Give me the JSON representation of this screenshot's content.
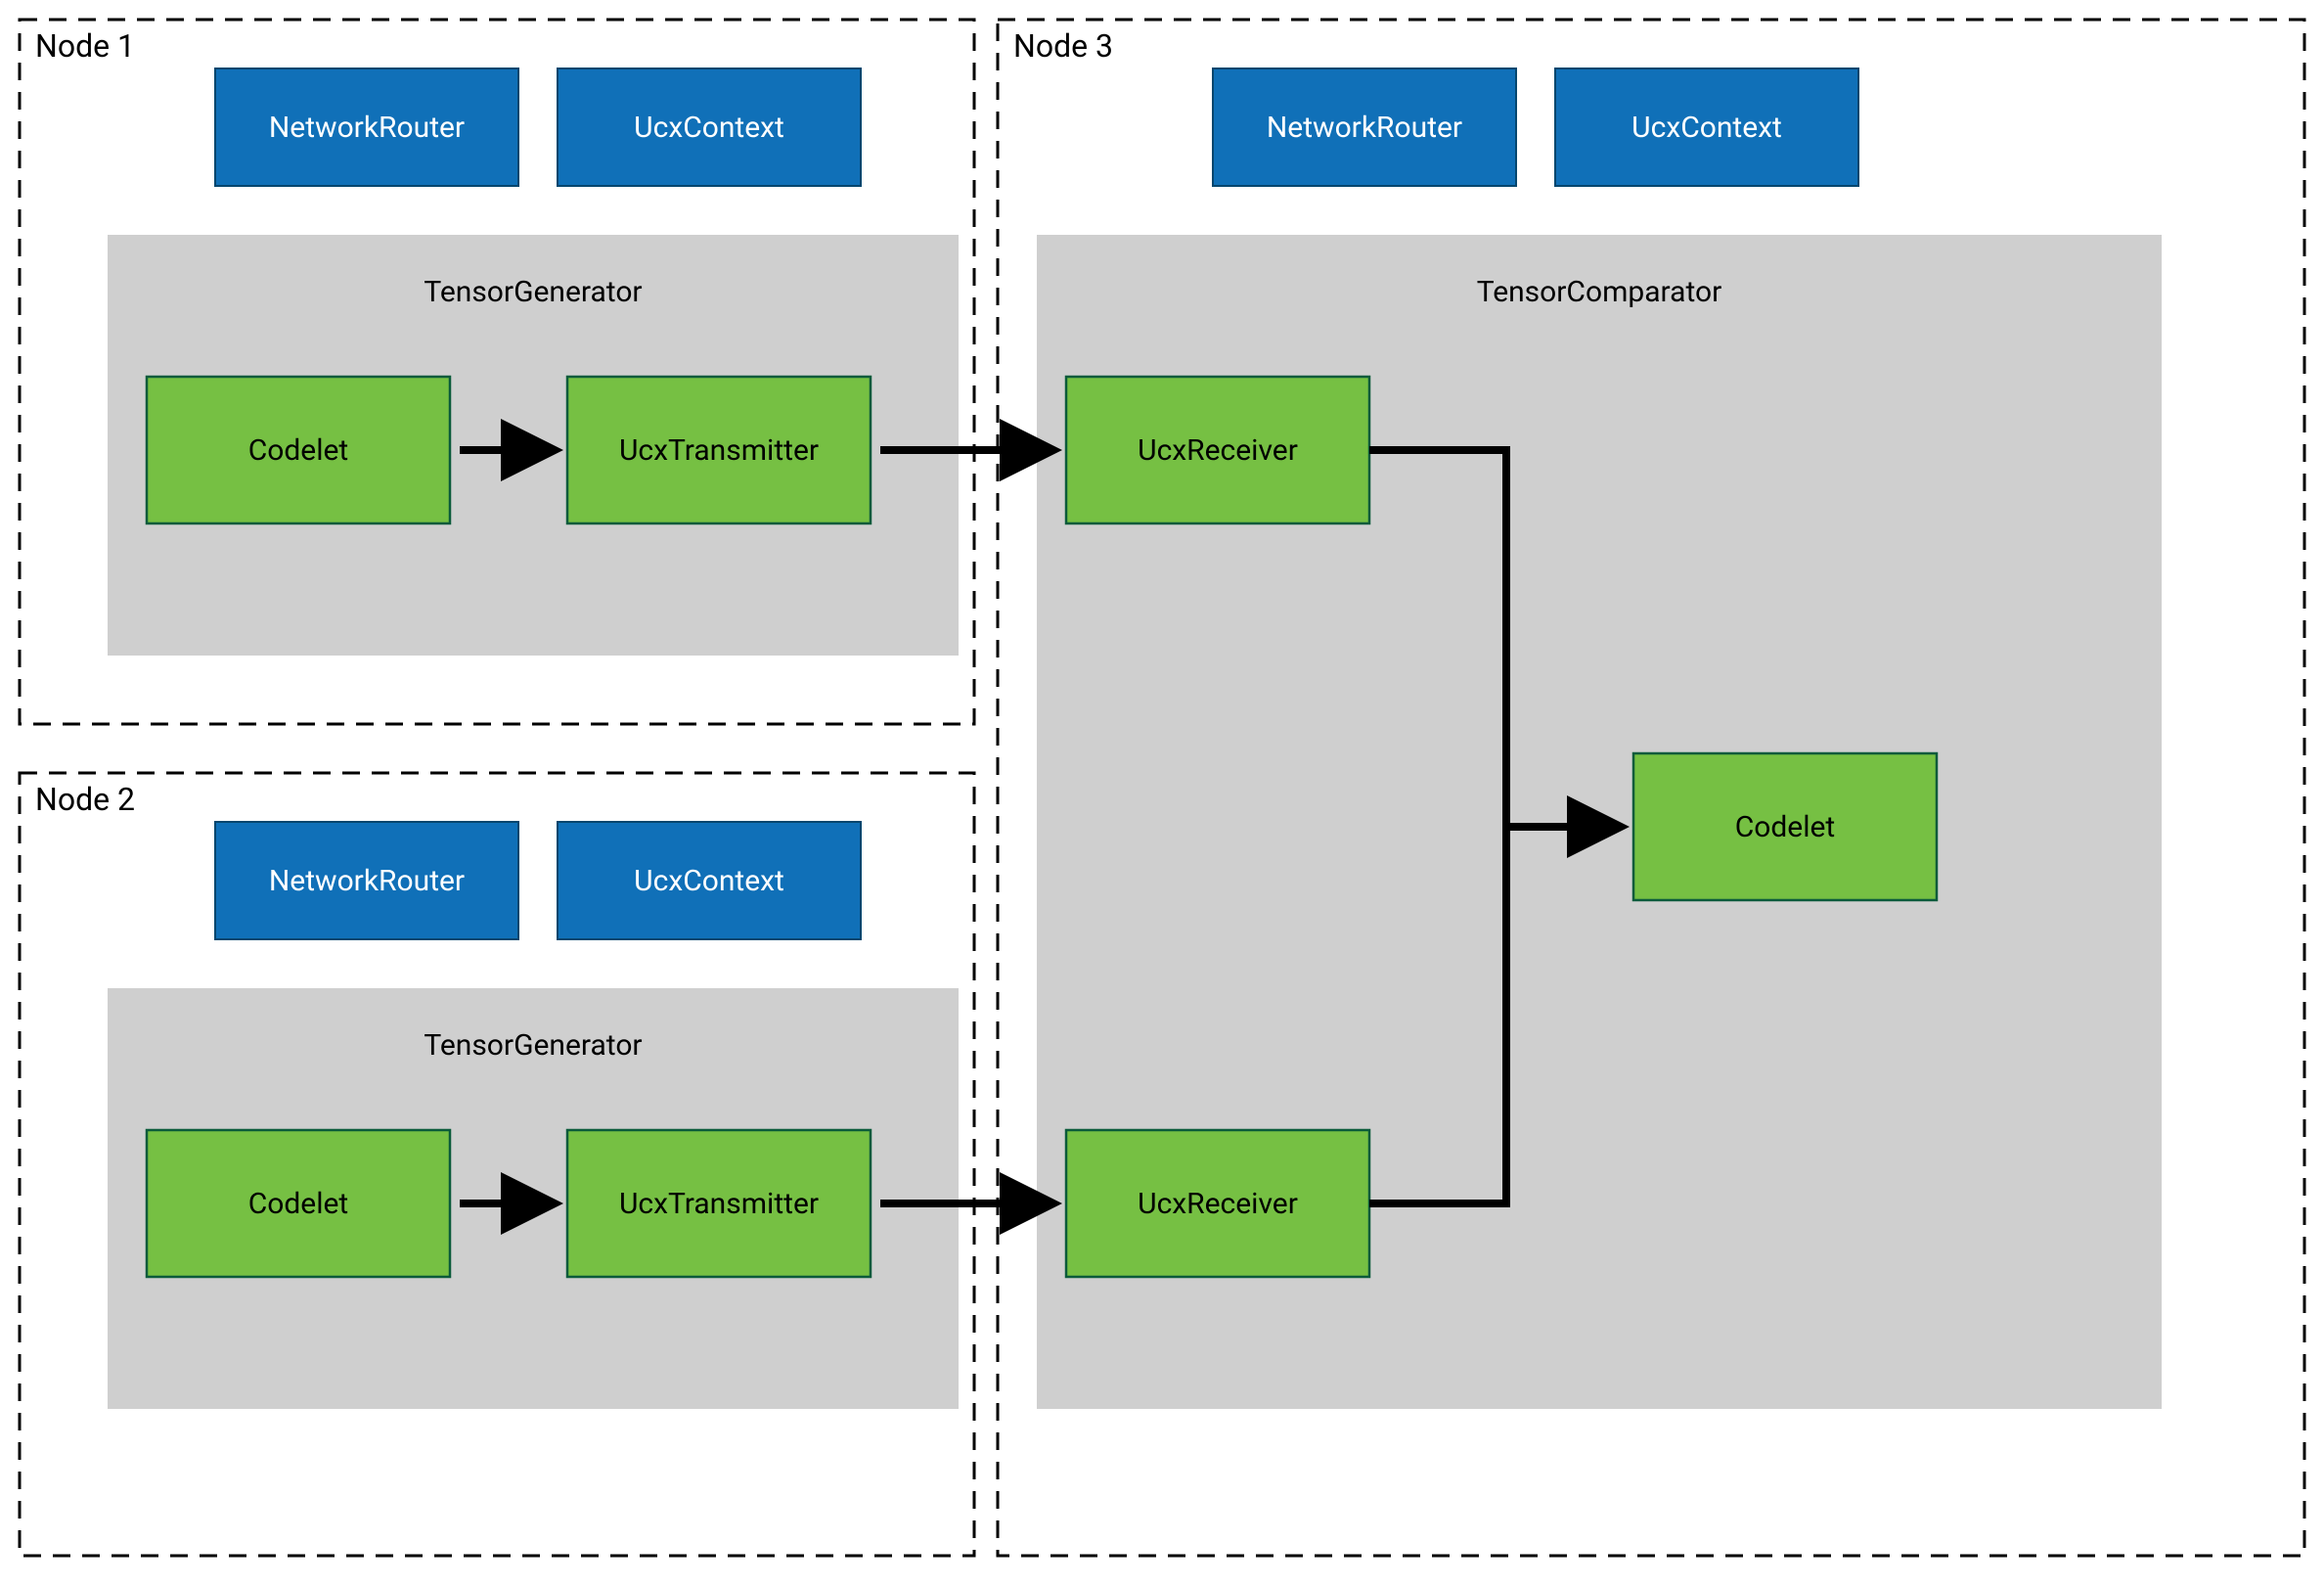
{
  "nodes": {
    "n1": {
      "label": "Node 1"
    },
    "n2": {
      "label": "Node 2"
    },
    "n3": {
      "label": "Node 3"
    }
  },
  "components": {
    "network_router": "NetworkRouter",
    "ucx_context": "UcxContext"
  },
  "fragments": {
    "tensor_generator": "TensorGenerator",
    "tensor_comparator": "TensorComparator"
  },
  "blocks": {
    "codelet": "Codelet",
    "ucx_transmitter": "UcxTransmitter",
    "ucx_receiver": "UcxReceiver"
  },
  "colors": {
    "blue": "#1070b8",
    "blue_border": "#03466e",
    "gray": "#cfcfcf",
    "green": "#76c043",
    "green_border": "#0b5b3b",
    "black": "#000000",
    "white": "#ffffff"
  }
}
